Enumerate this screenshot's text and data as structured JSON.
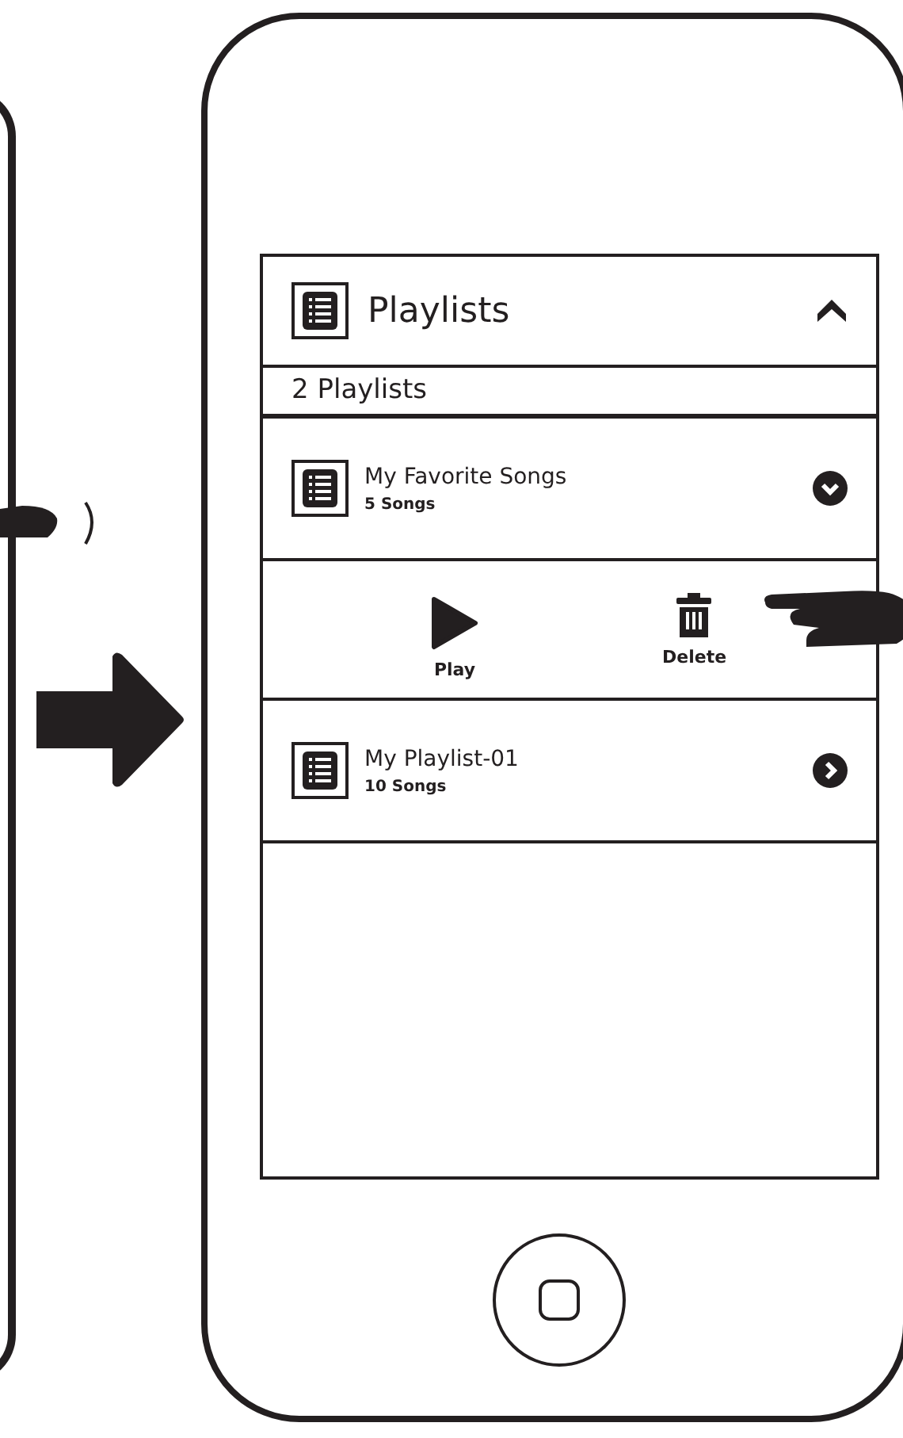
{
  "panel": {
    "title": "Playlists",
    "expanded": true,
    "count": "2 Playlists"
  },
  "playlists": [
    {
      "name": "My Favorite Songs",
      "songs": "5 Songs",
      "expanded": true,
      "actions": [
        {
          "kind": "play",
          "label": "Play"
        },
        {
          "kind": "delete",
          "label": "Delete"
        }
      ]
    },
    {
      "name": "My Playlist-01",
      "songs": "10 Songs",
      "expanded": false
    }
  ]
}
